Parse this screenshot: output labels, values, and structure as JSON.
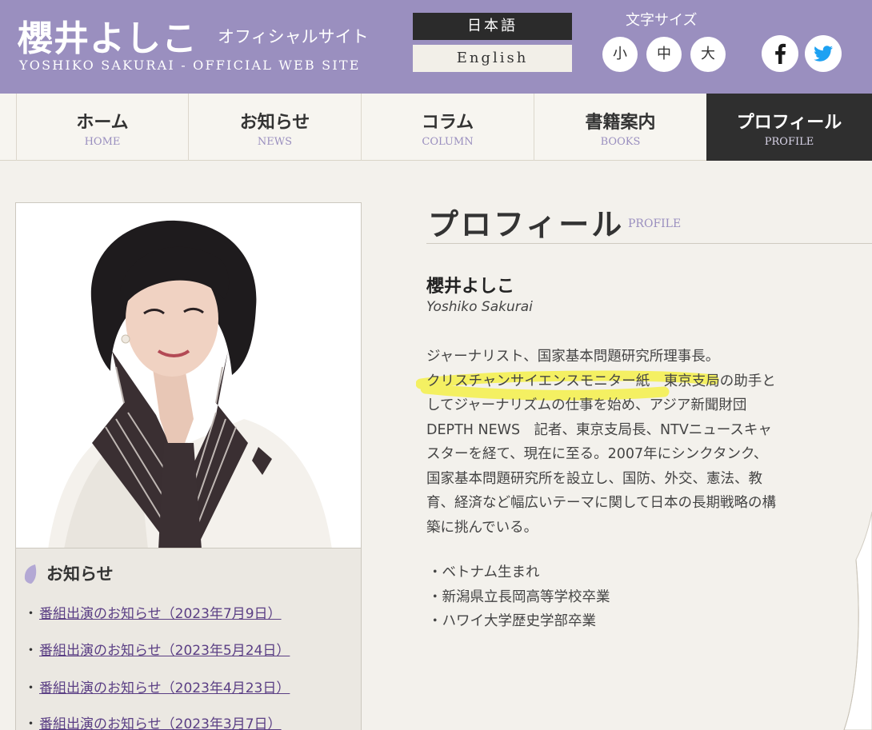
{
  "header": {
    "title": "櫻井よしこ",
    "subtitle": "オフィシャルサイト",
    "english_title": "YOSHIKO SAKURAI - OFFICIAL WEB SITE",
    "lang_japanese": "日本語",
    "lang_english": "English",
    "font_size_label": "文字サイズ",
    "font_sizes": [
      "小",
      "中",
      "大"
    ],
    "social_icons": [
      "facebook-icon",
      "twitter-icon"
    ],
    "accent_color": "#9a8fbf"
  },
  "nav": {
    "items": [
      {
        "ja": "ホーム",
        "en": "HOME"
      },
      {
        "ja": "お知らせ",
        "en": "NEWS"
      },
      {
        "ja": "コラム",
        "en": "COLUMN"
      },
      {
        "ja": "書籍案内",
        "en": "BOOKS"
      },
      {
        "ja": "プロフィール",
        "en": "PROFILE"
      }
    ],
    "active": "PROFILE"
  },
  "sidebar": {
    "news_heading": "お知らせ",
    "news_items": [
      "番組出演のお知らせ（2023年7月9日）",
      "番組出演のお知らせ（2023年5月24日）",
      "番組出演のお知らせ（2023年4月23日）",
      "番組出演のお知らせ（2023年3月7日）"
    ]
  },
  "profile": {
    "heading": "プロフィール",
    "heading_en": "PROFILE",
    "name": "櫻井よしこ",
    "name_en": "Yoshiko Sakurai",
    "bio_lines": [
      "ジャーナリスト、国家基本問題研究所理事長。",
      "クリスチャンサイエンスモニター紙　東京支局の助手と",
      "してジャーナリズムの仕事を始め、アジア新聞財団",
      "DEPTH NEWS　記者、東京支局長、NTVニュースキャ",
      "スターを経て、現在に至る。2007年にシンクタンク、",
      "国家基本問題研究所を設立し、国防、外交、憲法、教",
      "育、経済など幅広いテーマに関して日本の長期戦略の構",
      "築に挑んでいる。"
    ],
    "facts": [
      "・ベトナム生まれ",
      "・新潟県立長岡高等学校卒業",
      "・ハワイ大学歴史学部卒業"
    ],
    "highlight_color": "#f3f04a"
  }
}
